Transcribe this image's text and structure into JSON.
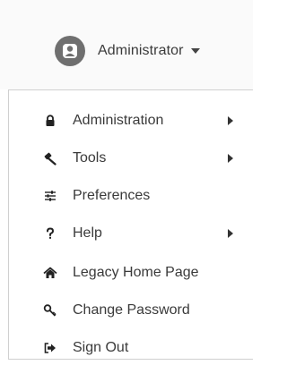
{
  "user": {
    "name": "Administrator"
  },
  "menu": {
    "items": [
      {
        "label": "Administration",
        "icon": "lock-icon",
        "has_submenu": true
      },
      {
        "label": "Tools",
        "icon": "gavel-icon",
        "has_submenu": true
      },
      {
        "label": "Preferences",
        "icon": "sliders-icon",
        "has_submenu": false
      },
      {
        "label": "Help",
        "icon": "question-icon",
        "has_submenu": true
      },
      {
        "label": "Legacy Home Page",
        "icon": "home-icon",
        "has_submenu": false
      },
      {
        "label": "Change Password",
        "icon": "key-icon",
        "has_submenu": false
      },
      {
        "label": "Sign Out",
        "icon": "sign-out-icon",
        "has_submenu": false
      }
    ]
  }
}
